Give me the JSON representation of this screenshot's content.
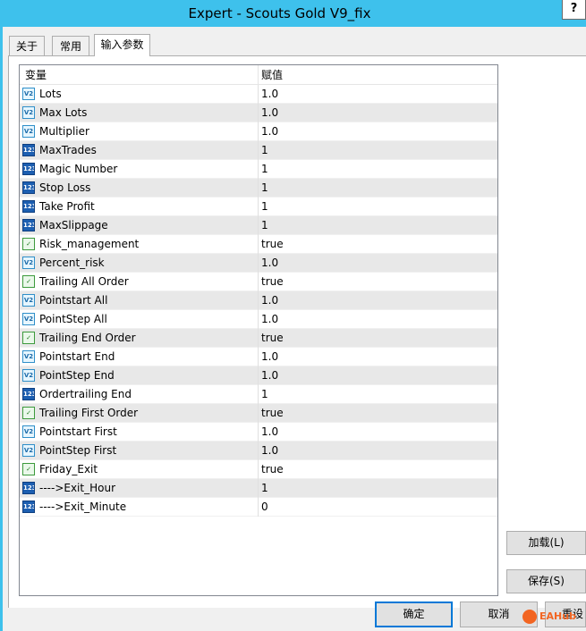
{
  "window": {
    "title": "Expert - Scouts Gold V9_fix",
    "help": "?"
  },
  "tabs": [
    {
      "label": "关于"
    },
    {
      "label": "常用"
    },
    {
      "label": "输入参数",
      "active": true
    }
  ],
  "grid": {
    "columns": {
      "variable": "变量",
      "value": "赋值"
    },
    "rows": [
      {
        "type": "double",
        "icon": "double-type-icon",
        "name": "Lots",
        "value": "1.0"
      },
      {
        "type": "double",
        "icon": "double-type-icon",
        "name": "Max Lots",
        "value": "1.0"
      },
      {
        "type": "double",
        "icon": "double-type-icon",
        "name": "Multiplier",
        "value": "1.0"
      },
      {
        "type": "int",
        "icon": "integer-type-icon",
        "name": "MaxTrades",
        "value": "1"
      },
      {
        "type": "int",
        "icon": "integer-type-icon",
        "name": "Magic Number",
        "value": "1"
      },
      {
        "type": "int",
        "icon": "integer-type-icon",
        "name": "Stop Loss",
        "value": "1"
      },
      {
        "type": "int",
        "icon": "integer-type-icon",
        "name": "Take Profit",
        "value": "1"
      },
      {
        "type": "int",
        "icon": "integer-type-icon",
        "name": "MaxSlippage",
        "value": "1"
      },
      {
        "type": "bool",
        "icon": "boolean-type-icon",
        "name": "Risk_management",
        "value": "true"
      },
      {
        "type": "double",
        "icon": "double-type-icon",
        "name": "Percent_risk",
        "value": "1.0"
      },
      {
        "type": "bool",
        "icon": "boolean-type-icon",
        "name": "Trailing All Order",
        "value": "true"
      },
      {
        "type": "double",
        "icon": "double-type-icon",
        "name": "Pointstart All",
        "value": "1.0"
      },
      {
        "type": "double",
        "icon": "double-type-icon",
        "name": "PointStep All",
        "value": "1.0"
      },
      {
        "type": "bool",
        "icon": "boolean-type-icon",
        "name": "Trailing End Order",
        "value": "true"
      },
      {
        "type": "double",
        "icon": "double-type-icon",
        "name": "Pointstart End",
        "value": "1.0"
      },
      {
        "type": "double",
        "icon": "double-type-icon",
        "name": "PointStep End",
        "value": "1.0"
      },
      {
        "type": "int",
        "icon": "integer-type-icon",
        "name": "Ordertrailing End",
        "value": "1"
      },
      {
        "type": "bool",
        "icon": "boolean-type-icon",
        "name": "Trailing First Order",
        "value": "true"
      },
      {
        "type": "double",
        "icon": "double-type-icon",
        "name": "Pointstart First",
        "value": "1.0"
      },
      {
        "type": "double",
        "icon": "double-type-icon",
        "name": "PointStep First",
        "value": "1.0"
      },
      {
        "type": "bool",
        "icon": "boolean-type-icon",
        "name": "Friday_Exit",
        "value": "true"
      },
      {
        "type": "int",
        "icon": "integer-type-icon",
        "name": "---->Exit_Hour",
        "value": "1"
      },
      {
        "type": "int",
        "icon": "integer-type-icon",
        "name": "---->Exit_Minute",
        "value": "0"
      }
    ]
  },
  "icon_text": {
    "double": "V2",
    "int": "123",
    "bool": "✓"
  },
  "buttons": {
    "load": "加载(L)",
    "save": "保存(S)",
    "ok": "确定",
    "cancel": "取消",
    "reset": "重设"
  },
  "watermark": "EAHub"
}
